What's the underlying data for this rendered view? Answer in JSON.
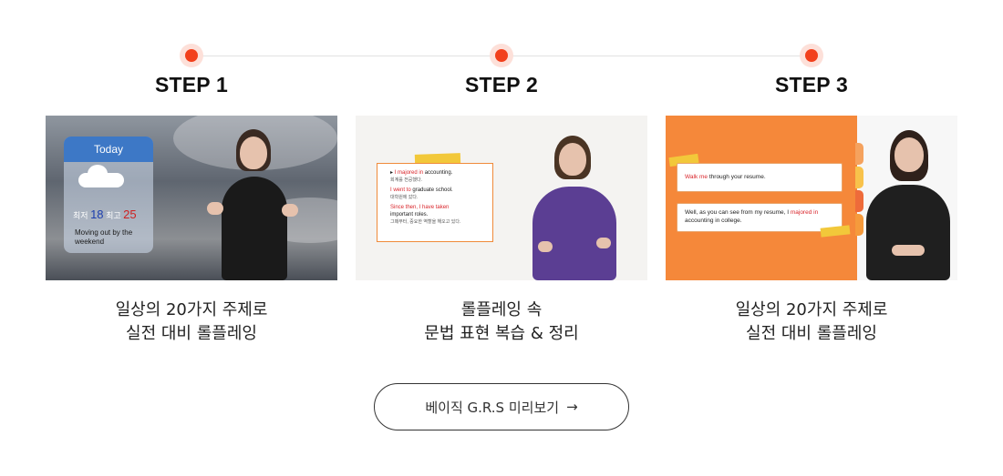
{
  "steps": [
    {
      "label": "STEP 1",
      "caption_line1": "일상의 20가지 주제로",
      "caption_line2": "실전 대비 롤플레잉"
    },
    {
      "label": "STEP 2",
      "caption_line1": "롤플레잉 속",
      "caption_line2": "문법 표현 복습 & 정리"
    },
    {
      "label": "STEP 3",
      "caption_line1": "일상의 20가지 주제로",
      "caption_line2": "실전 대비 롤플레잉"
    }
  ],
  "thumb1": {
    "weather_title": "Today",
    "low_label": "최저",
    "low_value": "18",
    "high_label": "최고",
    "high_value": "25",
    "note": "Moving out by the weekend"
  },
  "thumb2": {
    "line1_red": "I majored in",
    "line1_rest": " accounting.",
    "line1_kr": "회계를 전공했다.",
    "line2_red": "I went to",
    "line2_rest": " graduate school.",
    "line2_kr": "대학원에 갔다.",
    "line3_red": "Since then, I have taken",
    "line3_rest": "important roles.",
    "line3_kr": "그때부터, 중요한 역할을 해오고 있다."
  },
  "thumb3": {
    "bubble1_red": "Walk me",
    "bubble1_rest": " through your resume.",
    "bubble2_pre": "Well, as you can see from my resume, I ",
    "bubble2_red": "majored in",
    "bubble2_rest": " accounting in college."
  },
  "preview_button": {
    "label": "베이직 G.R.S 미리보기",
    "arrow": "→"
  },
  "colors": {
    "accent": "#f2401c",
    "accent_halo": "#fde0d9",
    "text": "#222222"
  },
  "icons": [
    "step-dot-icon",
    "arrow-right-icon",
    "cloud-icon"
  ]
}
